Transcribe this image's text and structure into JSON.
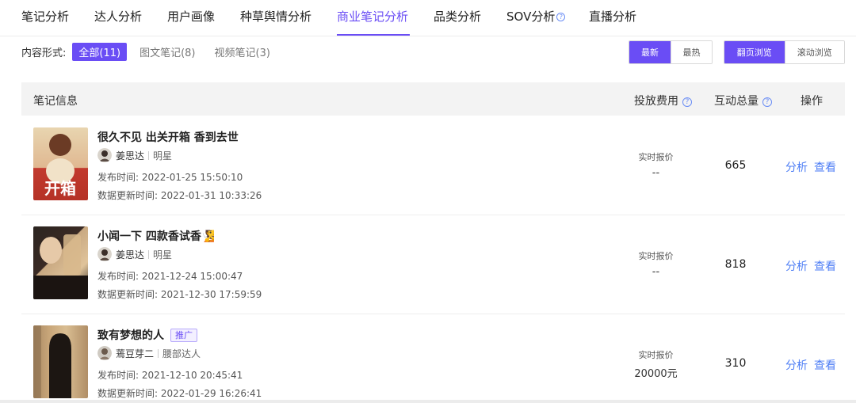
{
  "tabs": [
    {
      "label": "笔记分析"
    },
    {
      "label": "达人分析"
    },
    {
      "label": "用户画像"
    },
    {
      "label": "种草舆情分析"
    },
    {
      "label": "商业笔记分析",
      "active": true
    },
    {
      "label": "品类分析"
    },
    {
      "label": "SOV分析"
    },
    {
      "label": "直播分析"
    }
  ],
  "help_icon": "?",
  "filter": {
    "label": "内容形式:",
    "options": [
      "全部(11)",
      "图文笔记(8)",
      "视频笔记(3)"
    ],
    "selected": "全部(11)"
  },
  "sort": {
    "options": [
      "最新",
      "最热"
    ],
    "selected": "最新"
  },
  "view_mode": {
    "options": [
      "翻页浏览",
      "滚动浏览"
    ],
    "selected": "翻页浏览"
  },
  "table": {
    "headers": {
      "info": "笔记信息",
      "cost": "投放费用",
      "interactions": "互动总量",
      "actions": "操作"
    },
    "rows": [
      {
        "title": "很久不见 出关开箱 香到去世",
        "badge": "",
        "author": "姜思达",
        "author_tag": "明星",
        "publish_time": "发布时间: 2022-01-25 15:50:10",
        "update_time": "数据更新时间: 2022-01-31 10:33:26",
        "price_label": "实时报价",
        "price_value": "--",
        "interactions": "665",
        "thumb_text": "开箱",
        "thumb_colors": [
          "#e8d5b0",
          "#c23a2e"
        ]
      },
      {
        "title": "小闻一下 四款香试香🧏",
        "badge": "",
        "author": "姜思达",
        "author_tag": "明星",
        "publish_time": "发布时间: 2021-12-24 15:00:47",
        "update_time": "数据更新时间: 2021-12-30 17:59:59",
        "price_label": "实时报价",
        "price_value": "--",
        "interactions": "818",
        "thumb_text": "",
        "thumb_colors": [
          "#d9b88f",
          "#3a2a24"
        ]
      },
      {
        "title": "致有梦想的人",
        "badge": "推广",
        "author": "蔫豆芽二",
        "author_tag": "腰部达人",
        "publish_time": "发布时间: 2021-12-10 20:45:41",
        "update_time": "数据更新时间: 2022-01-29 16:26:41",
        "price_label": "实时报价",
        "price_value": "20000元",
        "interactions": "310",
        "thumb_text": "",
        "thumb_colors": [
          "#c9a77a",
          "#1c1612"
        ]
      }
    ],
    "action_labels": {
      "analyze": "分析",
      "view": "查看"
    }
  },
  "colors": {
    "accent": "#6a4df5",
    "link": "#4e7ef5",
    "header_bg": "#f3f3f3"
  }
}
